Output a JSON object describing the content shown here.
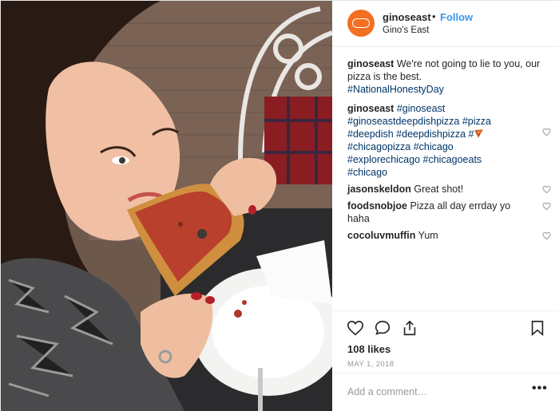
{
  "post": {
    "username": "ginoseast",
    "follow_label": "Follow",
    "separator": "•",
    "location": "Gino's East",
    "avatar_text": "GINO'S EAST",
    "brand_color": "#f36f21"
  },
  "caption": {
    "user": "ginoseast",
    "text": "We're not going to lie to you, our pizza is the best.",
    "hashtag": "#NationalHonestyDay"
  },
  "comments": [
    {
      "user": "ginoseast",
      "tags_line1": "#ginoseast",
      "tags_line2": "#ginoseastdeepdishpizza #pizza",
      "tags_line3": "#deepdish #deepdishpizza #",
      "emoji": "pizza-icon",
      "tags_line4": "#chicagopizza #chicago",
      "tags_line5": "#explorechicago #chicagoeats",
      "tags_line6": "#chicago"
    },
    {
      "user": "jasonskeldon",
      "text": "Great shot!"
    },
    {
      "user": "foodsnobjoe",
      "text": "Pizza all day errday yo haha"
    },
    {
      "user": "cocoluvmuffin",
      "text": "Yum"
    }
  ],
  "actions": {
    "icons": [
      "heart-icon",
      "comment-icon",
      "share-icon",
      "bookmark-icon"
    ],
    "likes": "108 likes",
    "date": "MAY 1, 2018"
  },
  "add_comment": {
    "placeholder": "Add a comment…",
    "more": "•••"
  },
  "colors": {
    "link": "#3897f0",
    "hashtag": "#003569",
    "muted": "#999999",
    "text": "#262626"
  }
}
